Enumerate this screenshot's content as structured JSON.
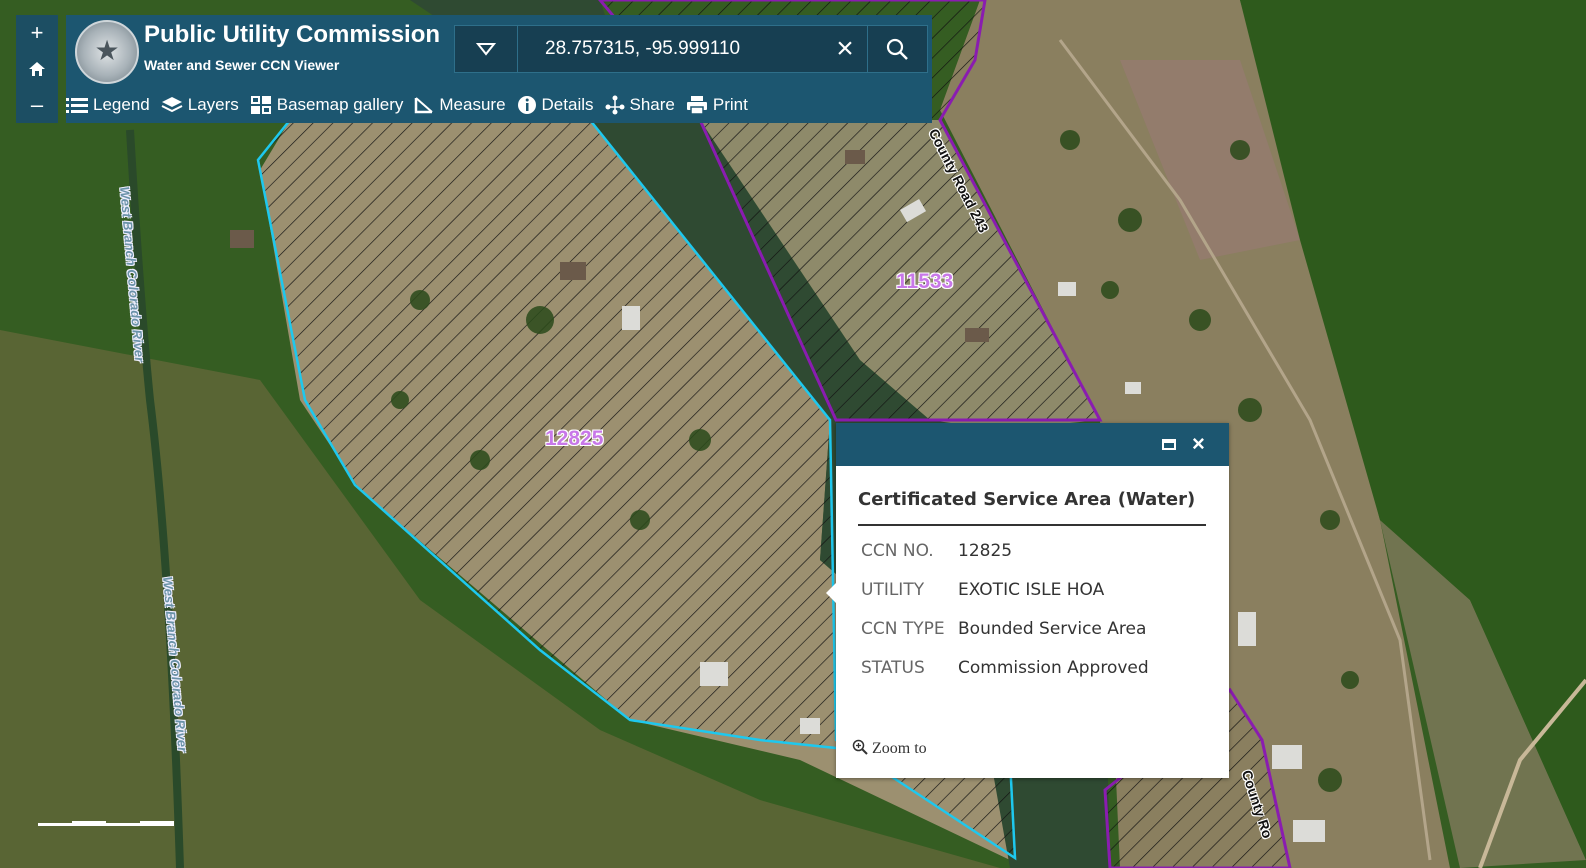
{
  "header": {
    "title": "Public Utility Commission",
    "subtitle": "Water and Sewer CCN Viewer"
  },
  "zoom": {
    "in": "+",
    "out": "–"
  },
  "search": {
    "value": "28.757315, -95.999110"
  },
  "toolbar": {
    "legend": "Legend",
    "layers": "Layers",
    "basemap": "Basemap gallery",
    "measure": "Measure",
    "details": "Details",
    "share": "Share",
    "print": "Print"
  },
  "map": {
    "ccn_labels": [
      "12825",
      "11533"
    ],
    "road_label_1": "County Road 243",
    "road_label_2": "County Ro",
    "river_label": "West Branch Colorado River"
  },
  "popup": {
    "title": "Certificated Service Area (Water)",
    "attributes": [
      {
        "key": "CCN NO.",
        "value": "12825"
      },
      {
        "key": "UTILITY",
        "value": "EXOTIC ISLE HOA"
      },
      {
        "key": "CCN TYPE",
        "value": "Bounded Service Area"
      },
      {
        "key": "STATUS",
        "value": "Commission Approved"
      }
    ],
    "zoom_to": "Zoom to"
  },
  "colors": {
    "header_bg": "#1c5670",
    "ccn_12825_outline": "#1ec8ee",
    "ccn_11533_outline": "#8a1cb0",
    "ccn_label": "#c878e8"
  }
}
